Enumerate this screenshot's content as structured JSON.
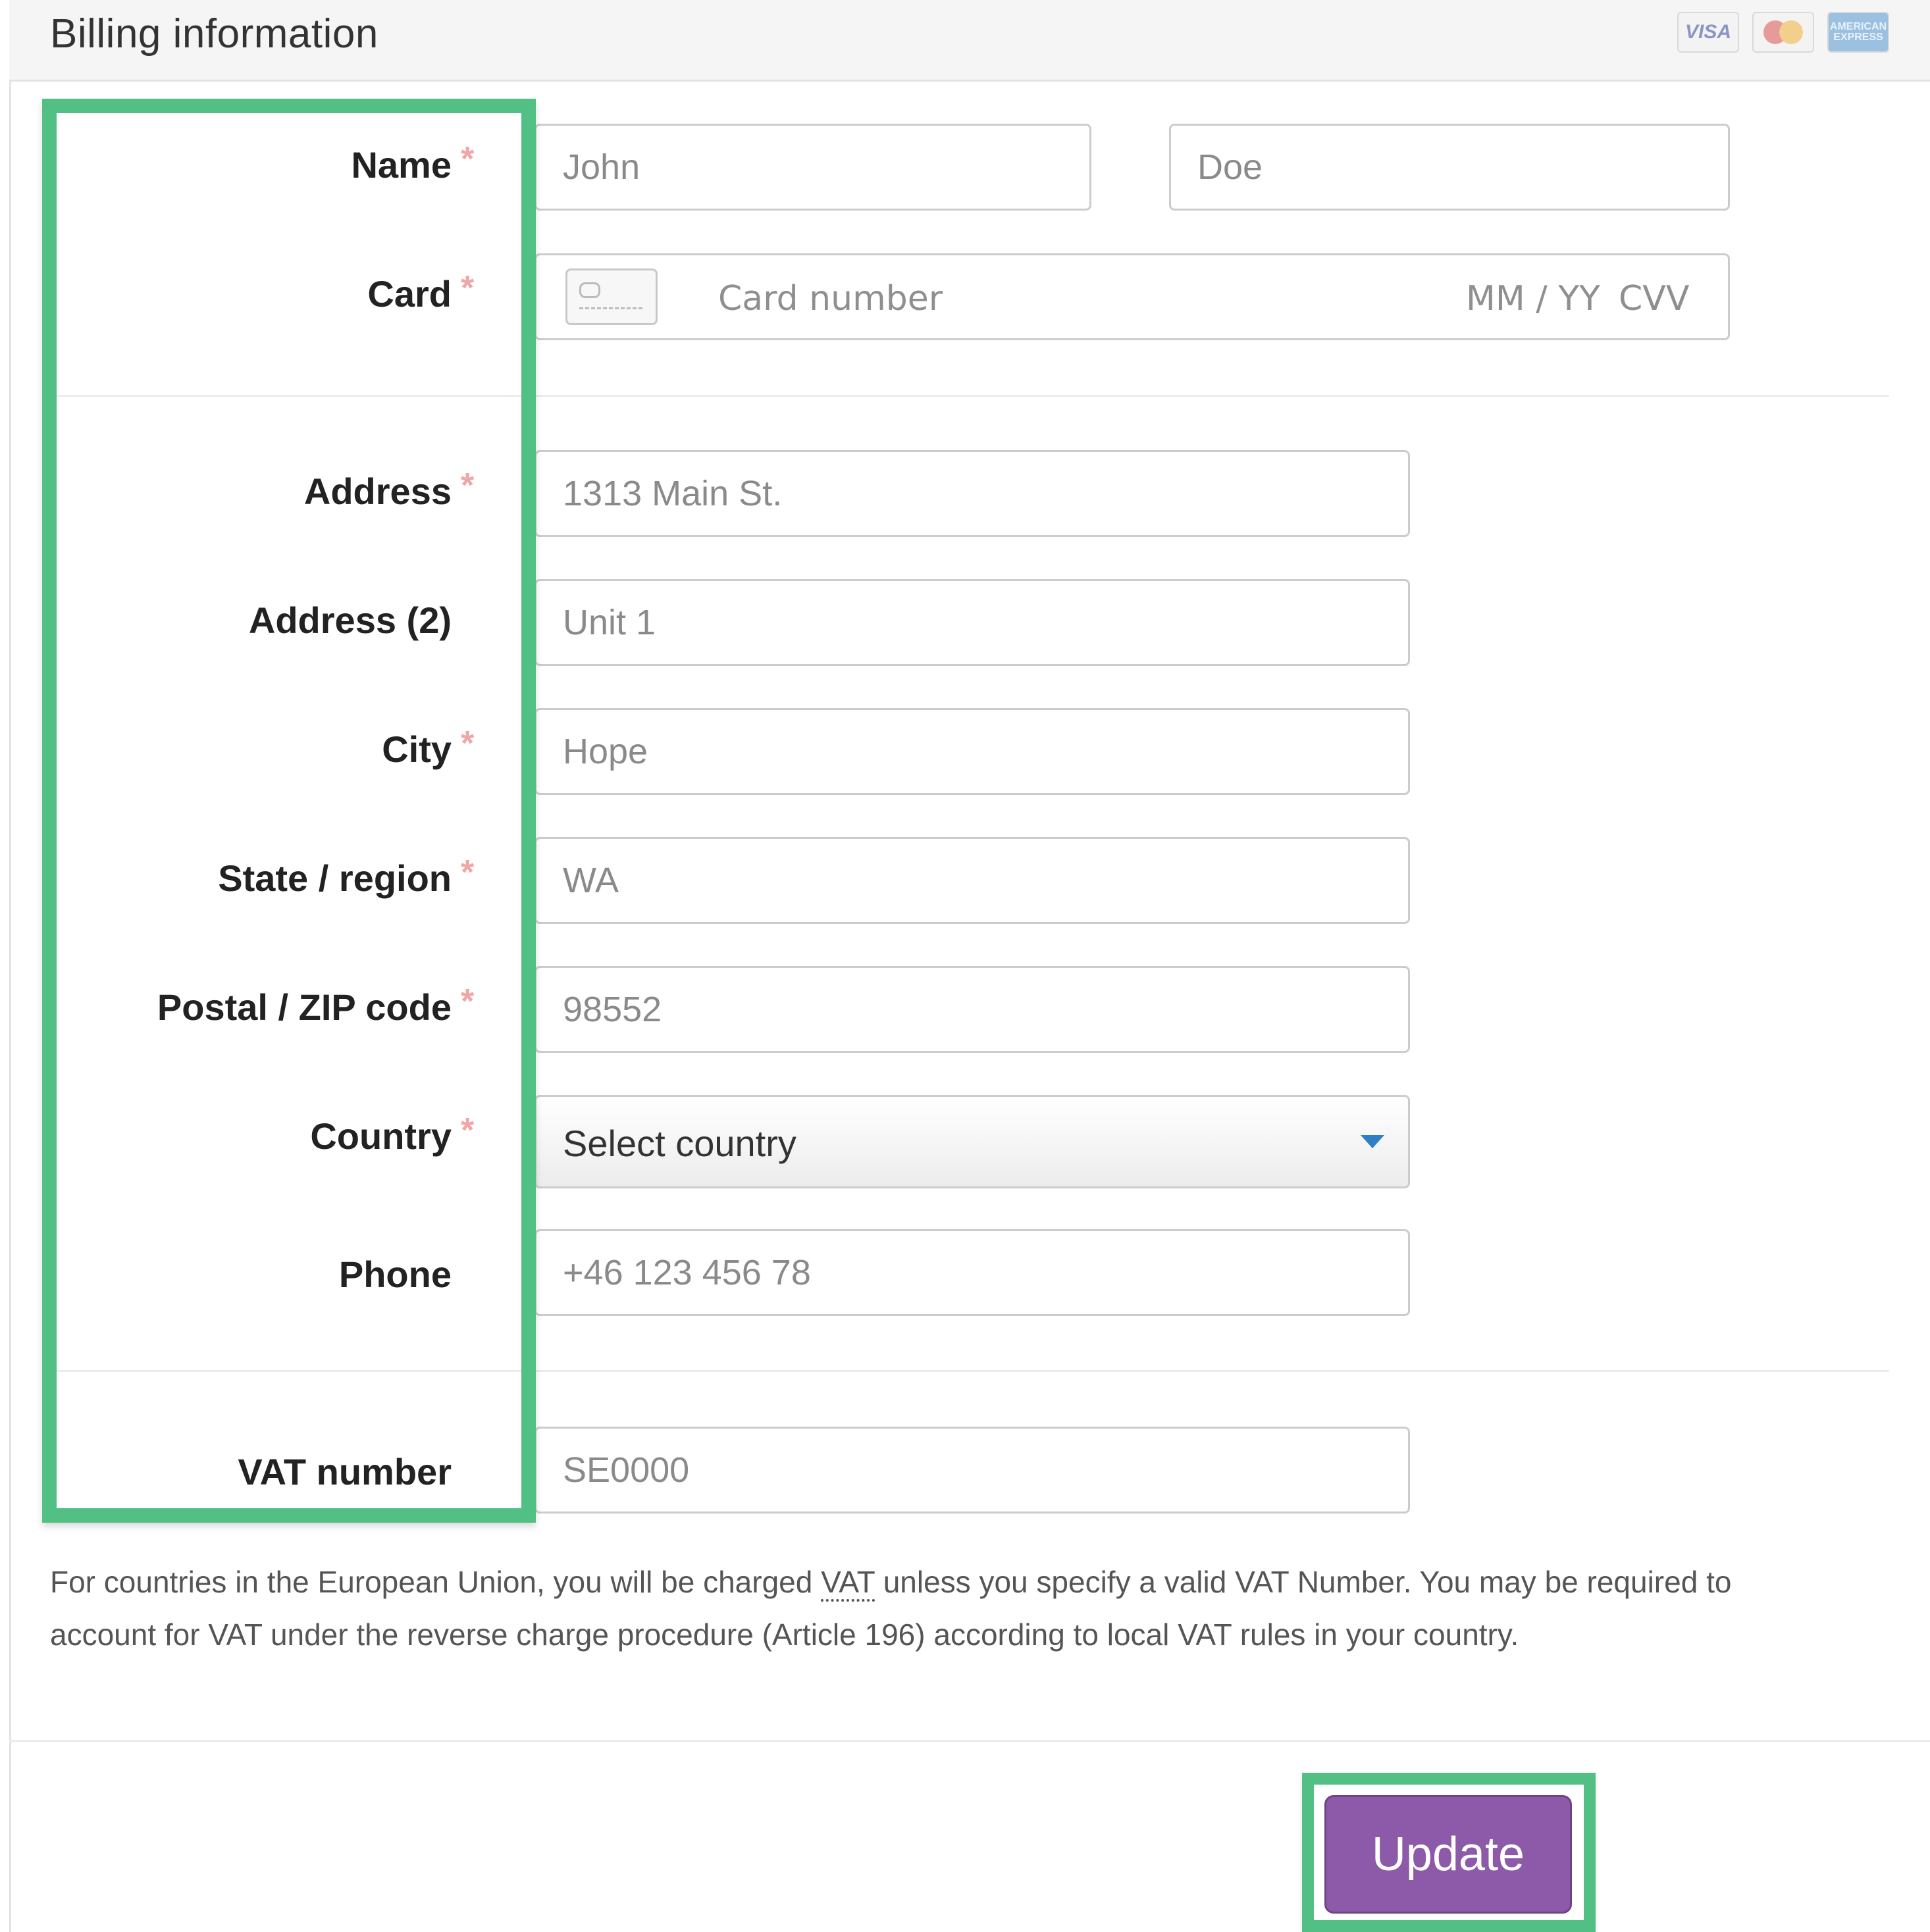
{
  "header": {
    "title": "Billing information",
    "card_logos": [
      "VISA",
      "MasterCard",
      "AMERICAN EXPRESS"
    ]
  },
  "form": {
    "name": {
      "label": "Name",
      "required": "*",
      "first_placeholder": "John",
      "last_placeholder": "Doe"
    },
    "card": {
      "label": "Card",
      "required": "*",
      "number_placeholder": "Card number",
      "expiry_placeholder": "MM / YY",
      "cvv_placeholder": "CVV"
    },
    "address": {
      "label": "Address",
      "required": "*",
      "placeholder": "1313 Main St."
    },
    "address2": {
      "label": "Address (2)",
      "placeholder": "Unit 1"
    },
    "city": {
      "label": "City",
      "required": "*",
      "placeholder": "Hope"
    },
    "state": {
      "label": "State / region",
      "required": "*",
      "placeholder": "WA"
    },
    "postal": {
      "label": "Postal / ZIP code",
      "required": "*",
      "placeholder": "98552"
    },
    "country": {
      "label": "Country",
      "required": "*",
      "selected": "Select country"
    },
    "phone": {
      "label": "Phone",
      "placeholder": "+46 123 456 78"
    },
    "vat": {
      "label": "VAT number",
      "placeholder": "SE0000"
    }
  },
  "note": {
    "before": "For countries in the European Union, you will be charged ",
    "abbr": "VAT",
    "after": " unless you specify a valid VAT Number. You may be required to account for VAT under the reverse charge procedure (Article 196) according to local VAT rules in your country."
  },
  "actions": {
    "update_label": "Update"
  },
  "colors": {
    "highlight": "#52bf84",
    "button": "#8c5aa8",
    "required": "#f0a6a6",
    "caret": "#2f7fc6"
  }
}
